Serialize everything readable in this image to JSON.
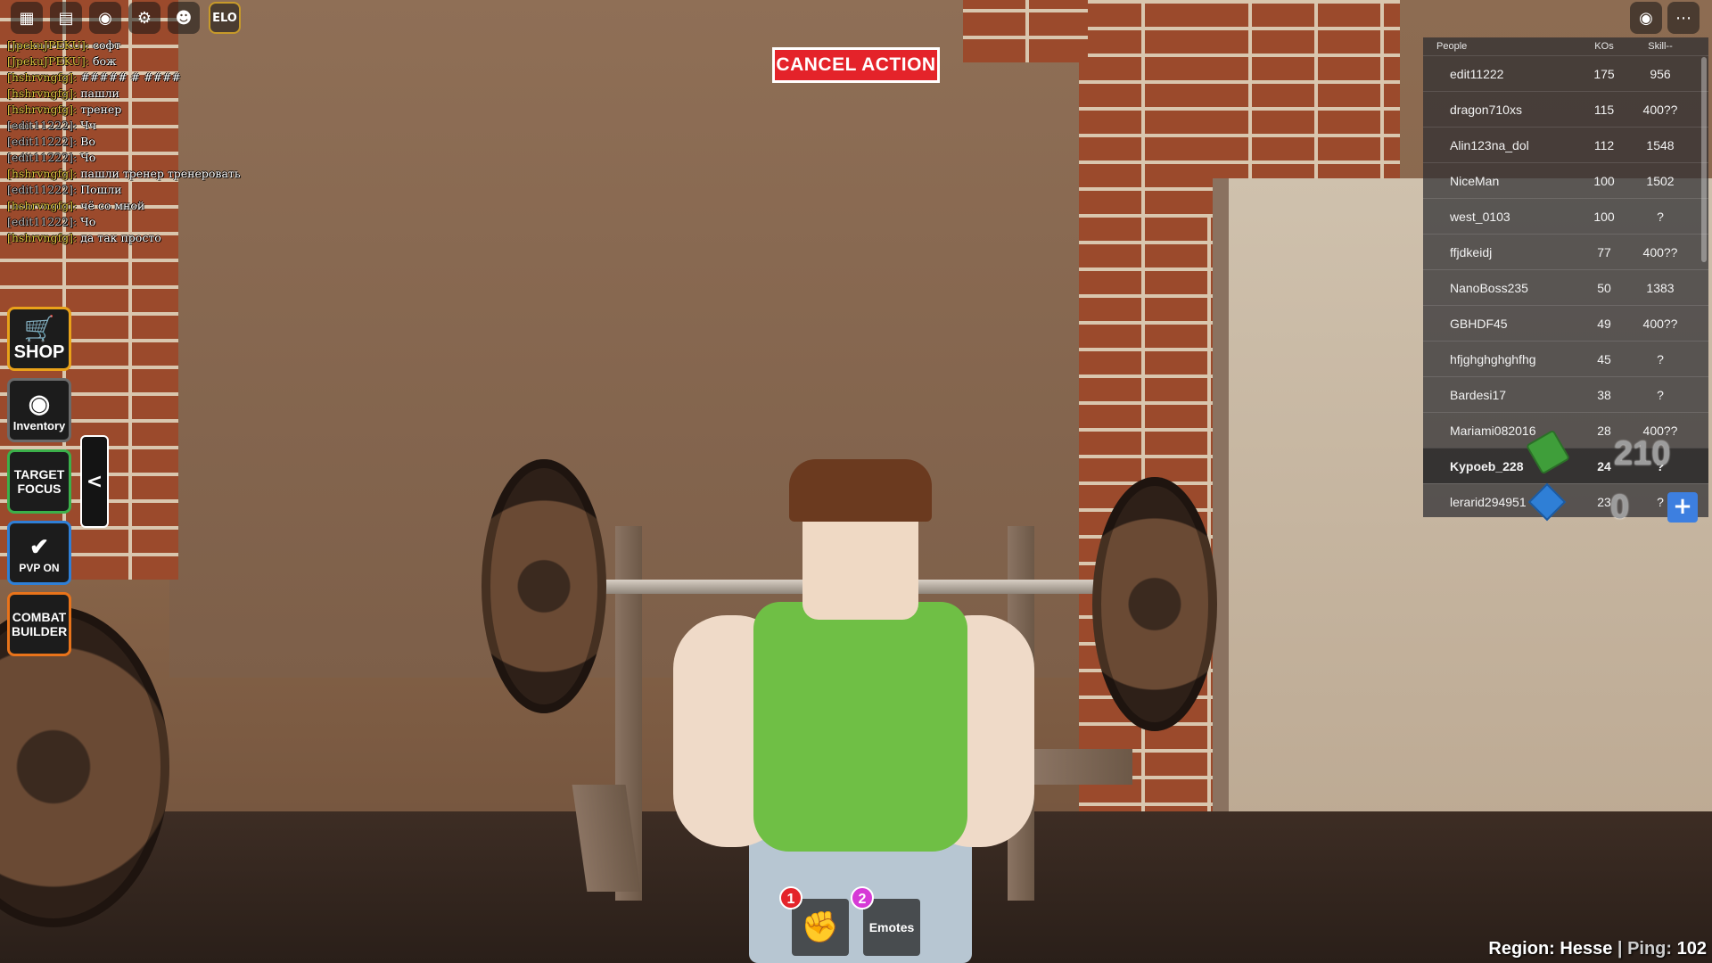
{
  "chat": [
    {
      "name": "[JpekuJPEKU]:",
      "msg": "софт",
      "gray": false
    },
    {
      "name": "[JpekuJPEKU]:",
      "msg": "бож",
      "gray": false
    },
    {
      "name": "[hshrvngfg]:",
      "msg": "##### # ####",
      "gray": false
    },
    {
      "name": "[hshrvngfg]:",
      "msg": "пашли",
      "gray": false
    },
    {
      "name": "[hshrvngfg]:",
      "msg": "тренер",
      "gray": false
    },
    {
      "name": "[edit11222]:",
      "msg": "Чч",
      "gray": true
    },
    {
      "name": "[edit11222]:",
      "msg": "Во",
      "gray": true
    },
    {
      "name": "[edit11222]:",
      "msg": "Чо",
      "gray": true
    },
    {
      "name": "[hshrvngfg]:",
      "msg": "пашли тренер тренеровать",
      "gray": false
    },
    {
      "name": "[edit11222]:",
      "msg": "Пошли",
      "gray": true
    },
    {
      "name": "[hshrvngfg]:",
      "msg": "чё со мной",
      "gray": false
    },
    {
      "name": "[edit11222]:",
      "msg": "Чо",
      "gray": true
    },
    {
      "name": "[hshrvngfg]:",
      "msg": "да так просто",
      "gray": false
    }
  ],
  "topbar": {
    "elo_label": "ELO"
  },
  "cancel_action_label": "CANCEL ACTION",
  "side_menu": {
    "shop": "SHOP",
    "inventory": "Inventory",
    "target_focus": "TARGET FOCUS",
    "pvp": "PVP ON",
    "combat_builder": "COMBAT BUILDER",
    "collapse": "<"
  },
  "leaderboard": {
    "headers": {
      "people": "People",
      "kos": "KOs",
      "skill": "Skill--"
    },
    "rows": [
      {
        "name": "edit11222",
        "kos": "175",
        "skill": "956"
      },
      {
        "name": "dragon710xs",
        "kos": "115",
        "skill": "400??"
      },
      {
        "name": "Alin123na_dol",
        "kos": "112",
        "skill": "1548"
      },
      {
        "name": "NiceMan",
        "kos": "100",
        "skill": "1502"
      },
      {
        "name": "west_0103",
        "kos": "100",
        "skill": "?"
      },
      {
        "name": "ffjdkeidj",
        "kos": "77",
        "skill": "400??"
      },
      {
        "name": "NanoBoss235",
        "kos": "50",
        "skill": "1383"
      },
      {
        "name": "GBHDF45",
        "kos": "49",
        "skill": "400??"
      },
      {
        "name": "hfjghghghghfhg",
        "kos": "45",
        "skill": "?"
      },
      {
        "name": "Bardesi17",
        "kos": "38",
        "skill": "?"
      },
      {
        "name": "Mariami082016",
        "kos": "28",
        "skill": "400??"
      },
      {
        "name": "Kypoeb_228",
        "kos": "24",
        "skill": "?"
      },
      {
        "name": "lerarid294951",
        "kos": "23",
        "skill": "?"
      }
    ]
  },
  "currency": {
    "cash": "210",
    "gems": "0",
    "add_label": "+"
  },
  "hotbar": [
    {
      "number": "1",
      "label": "",
      "icon": "fist-icon",
      "badge_color": "#e4232a"
    },
    {
      "number": "2",
      "label": "Emotes",
      "icon": "",
      "badge_color": "#d63ad6"
    }
  ],
  "status": {
    "region_label": "Region:",
    "region": "Hesse",
    "ping_label": "Ping:",
    "ping": "102"
  }
}
